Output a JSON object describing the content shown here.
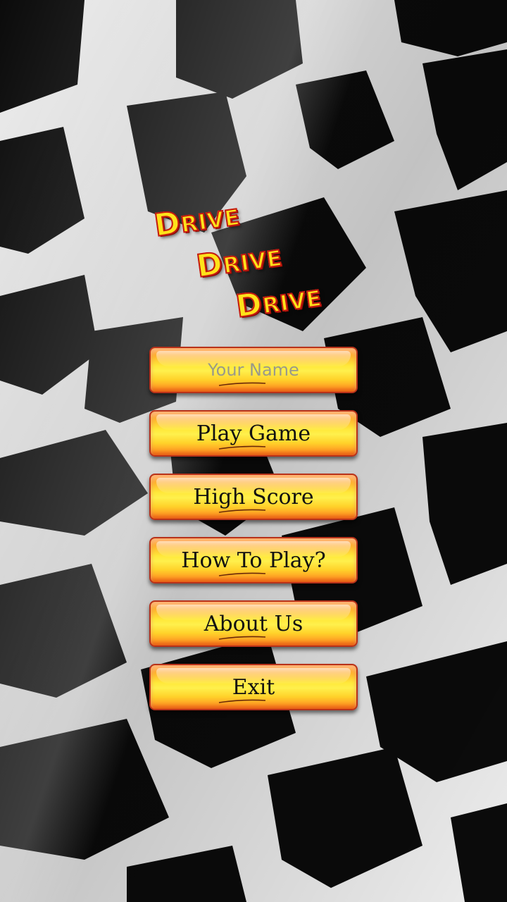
{
  "logo": {
    "lines": [
      "Drive",
      "Drive",
      "Drive"
    ]
  },
  "menu": {
    "name_input": {
      "placeholder": "Your Name",
      "value": ""
    },
    "play_label": "Play Game",
    "high_score_label": "High Score",
    "how_to_label": "How To Play?",
    "about_label": "About Us",
    "exit_label": "Exit"
  },
  "background": {
    "pattern": "checkered-flag",
    "colors": {
      "dark": "#0b0b0b",
      "light": "#f2f2f2"
    }
  },
  "theme": {
    "button_fill": "#ffe83a",
    "button_border": "#b8321a",
    "logo_fill": "#ffe21a",
    "logo_outline": "#c41a10"
  }
}
